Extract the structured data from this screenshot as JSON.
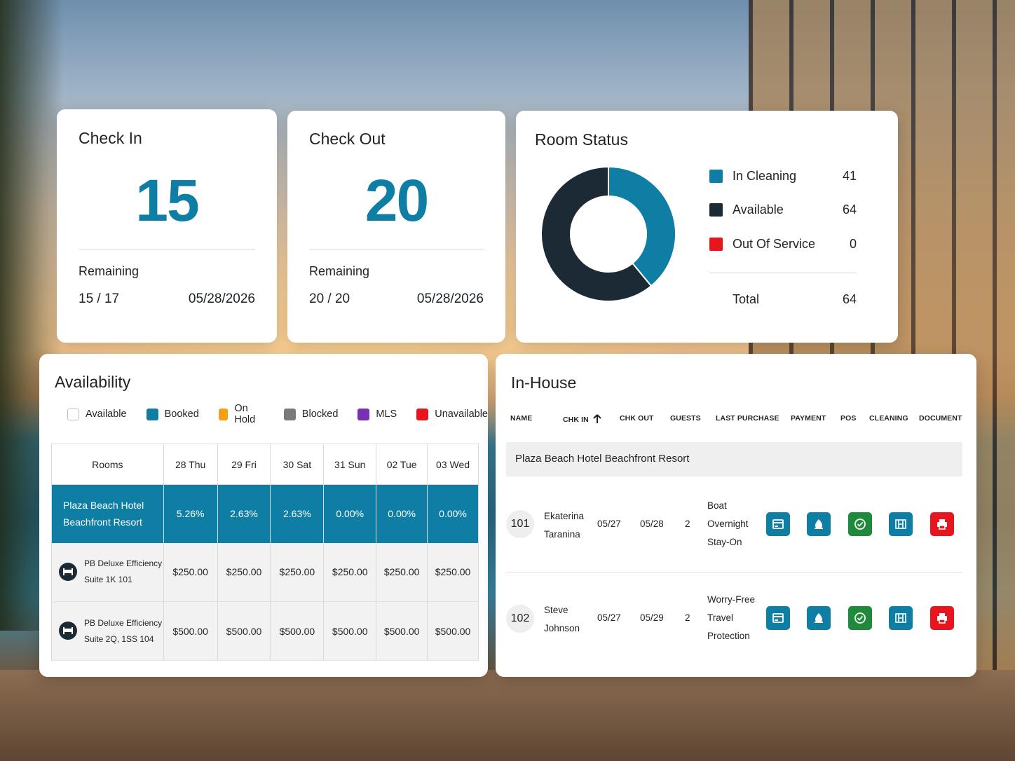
{
  "check_in": {
    "title": "Check In",
    "count": "15",
    "remaining_label": "Remaining",
    "remaining": "15 / 17",
    "date": "05/28/2026"
  },
  "check_out": {
    "title": "Check Out",
    "count": "20",
    "remaining_label": "Remaining",
    "remaining": "20 / 20",
    "date": "05/28/2026"
  },
  "room_status": {
    "title": "Room Status",
    "items": [
      {
        "label": "In Cleaning",
        "value": "41",
        "color": "#0f7ea4"
      },
      {
        "label": "Available",
        "value": "64",
        "color": "#1b2a34"
      },
      {
        "label": "Out Of Service",
        "value": "0",
        "color": "#e8151f"
      }
    ],
    "total_label": "Total",
    "total": "64"
  },
  "chart_data": {
    "type": "pie",
    "categories": [
      "In Cleaning",
      "Available",
      "Out Of Service"
    ],
    "values": [
      41,
      64,
      0
    ]
  },
  "availability": {
    "title": "Availability",
    "legend": [
      {
        "label": "Available",
        "color": "#ffffff"
      },
      {
        "label": "Booked",
        "color": "#0f7ea4"
      },
      {
        "label": "On Hold",
        "color": "#f5a00f"
      },
      {
        "label": "Blocked",
        "color": "#7a7a7a"
      },
      {
        "label": "MLS",
        "color": "#7b2fb5"
      },
      {
        "label": "Unavailable",
        "color": "#e8151f"
      }
    ],
    "columns": [
      "Rooms",
      "28 Thu",
      "29 Fri",
      "30 Sat",
      "31 Sun",
      "02 Tue",
      "03 Wed"
    ],
    "hotel": {
      "name_line1": "Plaza Beach Hotel",
      "name_line2": "Beachfront Resort",
      "values": [
        "5.26%",
        "2.63%",
        "2.63%",
        "0.00%",
        "0.00%",
        "0.00%"
      ]
    },
    "rooms": [
      {
        "line1": "PB Deluxe Efficiency",
        "line2": "Suite 1K 101",
        "values": [
          "$250.00",
          "$250.00",
          "$250.00",
          "$250.00",
          "$250.00",
          "$250.00"
        ]
      },
      {
        "line1": "PB Deluxe Efficiency",
        "line2": "Suite 2Q, 1SS 104",
        "values": [
          "$500.00",
          "$500.00",
          "$500.00",
          "$500.00",
          "$500.00",
          "$500.00"
        ]
      }
    ]
  },
  "in_house": {
    "title": "In-House",
    "headers": [
      "NAME",
      "CHK IN",
      "CHK OUT",
      "GUESTS",
      "LAST PURCHASE",
      "PAYMENT",
      "POS",
      "CLEANING",
      "DOCUMENT"
    ],
    "group": "Plaza Beach Hotel Beachfront Resort",
    "guests": [
      {
        "room": "101",
        "first": "Ekaterina",
        "last": "Taranina",
        "chk_in": "05/27",
        "chk_out": "05/28",
        "guests": "2",
        "purchase_1": "Boat",
        "purchase_2": "Overnight",
        "purchase_3": "Stay-On"
      },
      {
        "room": "102",
        "first": "Steve",
        "last": "Johnson",
        "chk_in": "05/27",
        "chk_out": "05/29",
        "guests": "2",
        "purchase_1": "Worry-Free",
        "purchase_2": "Travel",
        "purchase_3": "Protection"
      }
    ],
    "action_icons": [
      "payment-icon",
      "pos-icon",
      "cleaning-check-icon",
      "document-icon",
      "print-icon"
    ],
    "action_colors": [
      "#0f7ea4",
      "#0f7ea4",
      "#1e8a3a",
      "#0f7ea4",
      "#e8151f"
    ]
  }
}
